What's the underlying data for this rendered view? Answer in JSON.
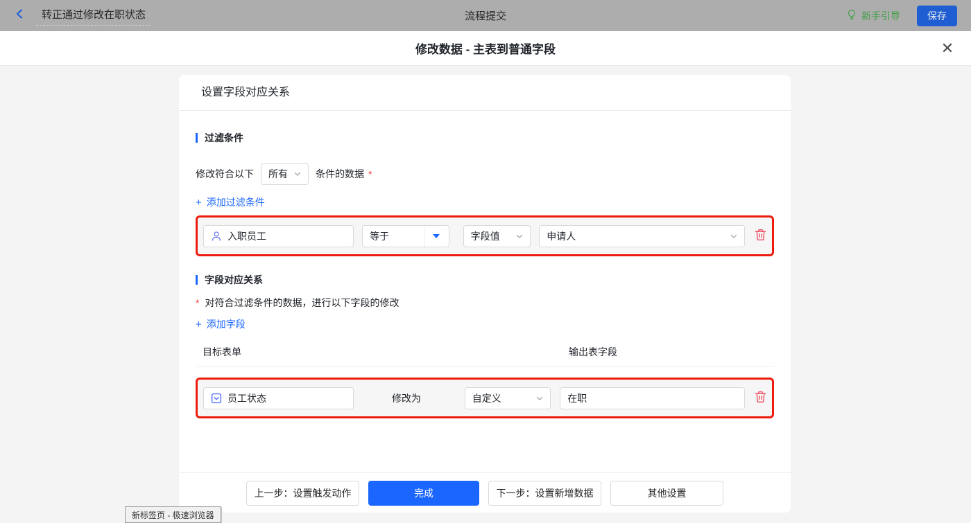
{
  "top_bar": {
    "workflow_title": "转正通过修改在职状态",
    "center_title": "流程提交",
    "guide_label": "新手引导",
    "save_label": "保存"
  },
  "modal": {
    "title": "修改数据 - 主表到普通字段",
    "close_icon": "✕",
    "panel_header": "设置字段对应关系",
    "filter_section": {
      "title": "过滤条件",
      "match_prefix": "修改符合以下",
      "match_select_value": "所有",
      "match_suffix": "条件的数据",
      "required_mark": "*",
      "plus_icon": "+",
      "add_link": "添加过滤条件",
      "row": {
        "field": "入职员工",
        "operator": "等于",
        "value_type": "字段值",
        "value": "申请人"
      }
    },
    "mapping_section": {
      "title": "字段对应关系",
      "required_mark": "*",
      "description": "对符合过滤条件的数据，进行以下字段的修改",
      "plus_icon": "+",
      "add_link": "添加字段",
      "col_target": "目标表单",
      "col_output": "输出表字段",
      "row": {
        "field": "员工状态",
        "modify_label": "修改为",
        "mode_select_value": "自定义",
        "value": "在职"
      }
    },
    "footer": {
      "prev_label": "上一步：设置触发动作",
      "done_label": "完成",
      "next_label": "下一步：设置新增数据",
      "other_label": "其他设置"
    }
  },
  "tooltip": {
    "text": "新标签页 - 极速浏览器"
  },
  "colors": {
    "accent_blue": "#1a66ff",
    "annotation_red": "#ed1b0c",
    "trash_red": "#ef4458",
    "guide_green": "#3f9e46",
    "required_red": "#f53f3f",
    "topbar_dimmed_gray": "#adadad",
    "body_gray": "#f4f4f5"
  }
}
